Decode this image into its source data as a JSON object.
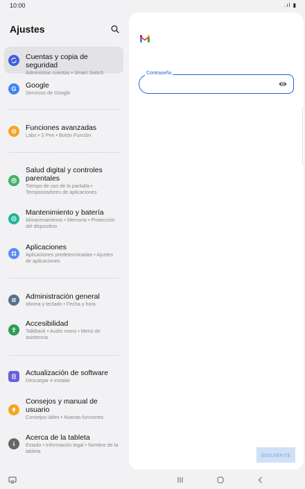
{
  "status_bar": {
    "time": "10:00",
    "signal_battery": ".ıl ▮"
  },
  "sidebar": {
    "title": "Ajustes",
    "items": [
      {
        "title": "Cuentas y copia de seguridad",
        "subtitle": "Administrar cuentas • Smart Switch",
        "icon": "sync-icon",
        "color": "#3f5fdc"
      },
      {
        "title": "Google",
        "subtitle": "Servicios de Google",
        "icon": "google-icon",
        "color": "#4285f4"
      },
      {
        "title": "Funciones avanzadas",
        "subtitle": "Labs • S Pen • Botón Función",
        "icon": "gear-plus-icon",
        "color": "#f5a623"
      },
      {
        "title": "Salud digital y controles parentales",
        "subtitle": "Tiempo de uso de la pantalla • Temporizadores de aplicaciones",
        "icon": "heart-circle-icon",
        "color": "#3fb168"
      },
      {
        "title": "Mantenimiento y batería",
        "subtitle": "Almacenamiento • Memoria • Protección del dispositivo",
        "icon": "maintenance-icon",
        "color": "#1fb59a"
      },
      {
        "title": "Aplicaciones",
        "subtitle": "Aplicaciones predeterminadas • Ajustes de aplicaciones",
        "icon": "apps-grid-icon",
        "color": "#5a8ff0"
      },
      {
        "title": "Administración general",
        "subtitle": "Idioma y teclado • Fecha y hora",
        "icon": "sliders-icon",
        "color": "#5a6f8a"
      },
      {
        "title": "Accesibilidad",
        "subtitle": "TalkBack • Audio mono • Menú de asistencia",
        "icon": "accessibility-icon",
        "color": "#2e9d55"
      },
      {
        "title": "Actualización de software",
        "subtitle": "Descargar e instalar",
        "icon": "update-icon",
        "color": "#6a5fdc"
      },
      {
        "title": "Consejos y manual de usuario",
        "subtitle": "Consejos útiles • Nuevas funciones",
        "icon": "lightbulb-icon",
        "color": "#f5a623"
      },
      {
        "title": "Acerca de la tableta",
        "subtitle": "Estado • Información legal • Nombre de la tableta",
        "icon": "info-icon",
        "color": "#666666"
      }
    ]
  },
  "signin": {
    "password_label": "Contraseña",
    "password_value": "",
    "next_label": "SIGUIENTE"
  },
  "colors": {
    "accent": "#1a63d8",
    "selected_bg": "#e3e3e6",
    "background": "#f2f2f4"
  }
}
